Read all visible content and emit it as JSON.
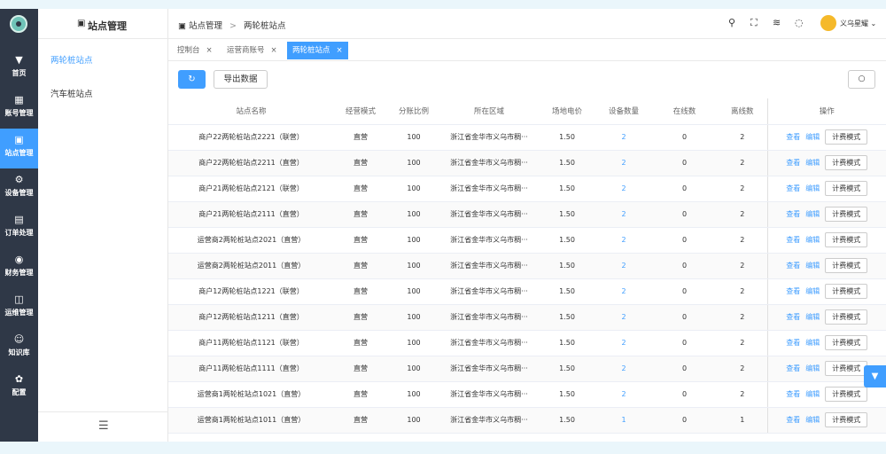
{
  "rail": {
    "items": [
      {
        "label": "首页",
        "icon": "▼",
        "active": false
      },
      {
        "label": "账号管理",
        "icon": "▦",
        "active": false
      },
      {
        "label": "站点管理",
        "icon": "▣",
        "active": true
      },
      {
        "label": "设备管理",
        "icon": "⚙",
        "active": false
      },
      {
        "label": "订单处理",
        "icon": "▤",
        "active": false
      },
      {
        "label": "财务管理",
        "icon": "◉",
        "active": false
      },
      {
        "label": "运维管理",
        "icon": "◫",
        "active": false
      },
      {
        "label": "知识库",
        "icon": "☺",
        "active": false
      },
      {
        "label": "配置",
        "icon": "✿",
        "active": false
      }
    ]
  },
  "subnav": {
    "title": "站点管理",
    "items": [
      {
        "label": "两轮桩站点",
        "active": true
      },
      {
        "label": "汽车桩站点",
        "active": false
      }
    ],
    "collapse_icon": "☰"
  },
  "topbar": {
    "crumb_root": "站点管理",
    "crumb_current": "两轮桩站点",
    "user_name": "义乌星耀"
  },
  "tabs": [
    {
      "label": "控制台",
      "active": false
    },
    {
      "label": "运营商账号",
      "active": false
    },
    {
      "label": "两轮桩站点",
      "active": true
    }
  ],
  "toolbar": {
    "refresh_icon": "↻",
    "export_label": "导出数据",
    "search_icon": "○"
  },
  "table": {
    "columns": [
      "站点名称",
      "经营模式",
      "分账比例",
      "所在区域",
      "场地电价",
      "设备数量",
      "在线数",
      "离线数",
      "操作"
    ],
    "rows": [
      [
        "商户22两轮桩站点2221（联营）",
        "直营",
        "100",
        "浙江省金华市义乌市稠···",
        "1.50",
        "2",
        "0",
        "2"
      ],
      [
        "商户22两轮桩站点2211（直营）",
        "直营",
        "100",
        "浙江省金华市义乌市稠···",
        "1.50",
        "2",
        "0",
        "2"
      ],
      [
        "商户21两轮桩站点2121（联营）",
        "直营",
        "100",
        "浙江省金华市义乌市稠···",
        "1.50",
        "2",
        "0",
        "2"
      ],
      [
        "商户21两轮桩站点2111（直营）",
        "直营",
        "100",
        "浙江省金华市义乌市稠···",
        "1.50",
        "2",
        "0",
        "2"
      ],
      [
        "运营商2两轮桩站点2021（直营）",
        "直营",
        "100",
        "浙江省金华市义乌市稠···",
        "1.50",
        "2",
        "0",
        "2"
      ],
      [
        "运营商2两轮桩站点2011（直营）",
        "直营",
        "100",
        "浙江省金华市义乌市稠···",
        "1.50",
        "2",
        "0",
        "2"
      ],
      [
        "商户12两轮桩站点1221（联营）",
        "直营",
        "100",
        "浙江省金华市义乌市稠···",
        "1.50",
        "2",
        "0",
        "2"
      ],
      [
        "商户12两轮桩站点1211（直营）",
        "直营",
        "100",
        "浙江省金华市义乌市稠···",
        "1.50",
        "2",
        "0",
        "2"
      ],
      [
        "商户11两轮桩站点1121（联营）",
        "直营",
        "100",
        "浙江省金华市义乌市稠···",
        "1.50",
        "2",
        "0",
        "2"
      ],
      [
        "商户11两轮桩站点1111（直营）",
        "直营",
        "100",
        "浙江省金华市义乌市稠···",
        "1.50",
        "2",
        "0",
        "2"
      ],
      [
        "运营商1两轮桩站点1021（直营）",
        "直营",
        "100",
        "浙江省金华市义乌市稠···",
        "1.50",
        "2",
        "0",
        "2"
      ],
      [
        "运营商1两轮桩站点1011（直营）",
        "直营",
        "100",
        "浙江省金华市义乌市稠···",
        "1.50",
        "1",
        "0",
        "1"
      ]
    ],
    "actions": {
      "view": "查看",
      "edit": "编辑",
      "billing": "计费模式"
    }
  },
  "colors": {
    "accent": "#409eff",
    "rail": "#2f3847"
  }
}
